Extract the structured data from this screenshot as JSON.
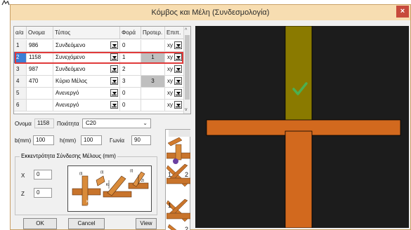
{
  "window": {
    "title": "Κόμβος και Μέλη (Συνδεσμολογία)",
    "close_glyph": "×"
  },
  "grid": {
    "columns": [
      "α/α",
      "Ονομα",
      "Τύπος",
      "Φορά",
      "Προτερ.",
      "Επιπ."
    ],
    "rows": [
      {
        "idx": "1",
        "name": "986",
        "type": "Συνδεόμενο",
        "dir": "0",
        "prio": "",
        "plane": "xy",
        "selected": false
      },
      {
        "idx": "2",
        "name": "1158",
        "type": "Συνεχόμενο",
        "dir": "1",
        "prio": "1",
        "plane": "xy",
        "selected": true
      },
      {
        "idx": "3",
        "name": "987",
        "type": "Συνδεόμενο",
        "dir": "2",
        "prio": "",
        "plane": "xy",
        "selected": false
      },
      {
        "idx": "4",
        "name": "470",
        "type": "Κύριο Μέλος",
        "dir": "3",
        "prio": "3",
        "plane": "xy",
        "selected": false
      },
      {
        "idx": "5",
        "name": "",
        "type": "Ανενεργό",
        "dir": "0",
        "prio": "",
        "plane": "xy",
        "selected": false
      },
      {
        "idx": "6",
        "name": "",
        "type": "Ανενεργό",
        "dir": "0",
        "prio": "",
        "plane": "xy",
        "selected": false
      }
    ],
    "scroll_up": "^",
    "scroll_down": "v"
  },
  "props": {
    "name_label": "Ονομα",
    "name_value": "1158",
    "quality_label": "Ποιότητα",
    "quality_value": "C20",
    "b_label": "b(mm)",
    "b_value": "100",
    "h_label": "h(mm)",
    "h_value": "100",
    "angle_label": "Γωνία",
    "angle_value": "90"
  },
  "eccentricity": {
    "title": "Εκκεντρότητα Σύνδεσης Μέλους (mm)",
    "x_label": "X",
    "x_value": "0",
    "z_label": "Z",
    "z_value": "0",
    "diagram_labels": {
      "i": "(i)",
      "k": "Ki",
      "zi": "Zi",
      "ki0": "Ki=0",
      "zi0": "Zi=0"
    }
  },
  "buttons": {
    "ok": "OK",
    "cancel": "Cancel",
    "view": "View"
  },
  "thumbnails": {
    "label_1": "1",
    "label_2": "2"
  },
  "colors": {
    "title_bar": "#f7ddb1",
    "selected_row": "#3b7fd6",
    "highlight": "#e03a3a",
    "canvas_bg": "#1c1c1c",
    "beam_orange": "#d2691e",
    "column_olive": "#8a7a00",
    "check_green": "#4caf50"
  }
}
